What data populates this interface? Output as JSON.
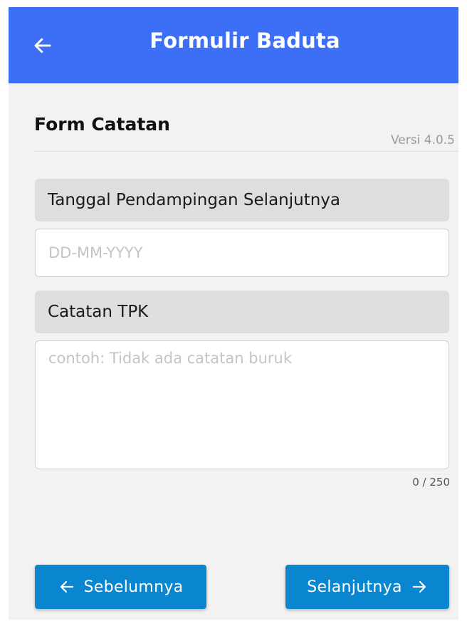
{
  "header": {
    "title": "Formulir Baduta",
    "back_icon": "arrow-left-icon",
    "background": "#3d6ef6"
  },
  "section": {
    "title": "Form Catatan",
    "version": "Versi 4.0.5"
  },
  "fields": {
    "next_visit": {
      "label": "Tanggal Pendampingan Selanjutnya",
      "placeholder": "DD-MM-YYYY",
      "value": ""
    },
    "tpk_note": {
      "label": "Catatan TPK",
      "placeholder": "contoh: Tidak ada catatan buruk",
      "value": "",
      "counter": "0 / 250"
    }
  },
  "footer": {
    "prev_label": "Sebelumnya",
    "prev_icon": "arrow-left-icon",
    "next_label": "Selanjutnya",
    "next_icon": "arrow-right-icon",
    "button_color": "#0a86d0"
  }
}
